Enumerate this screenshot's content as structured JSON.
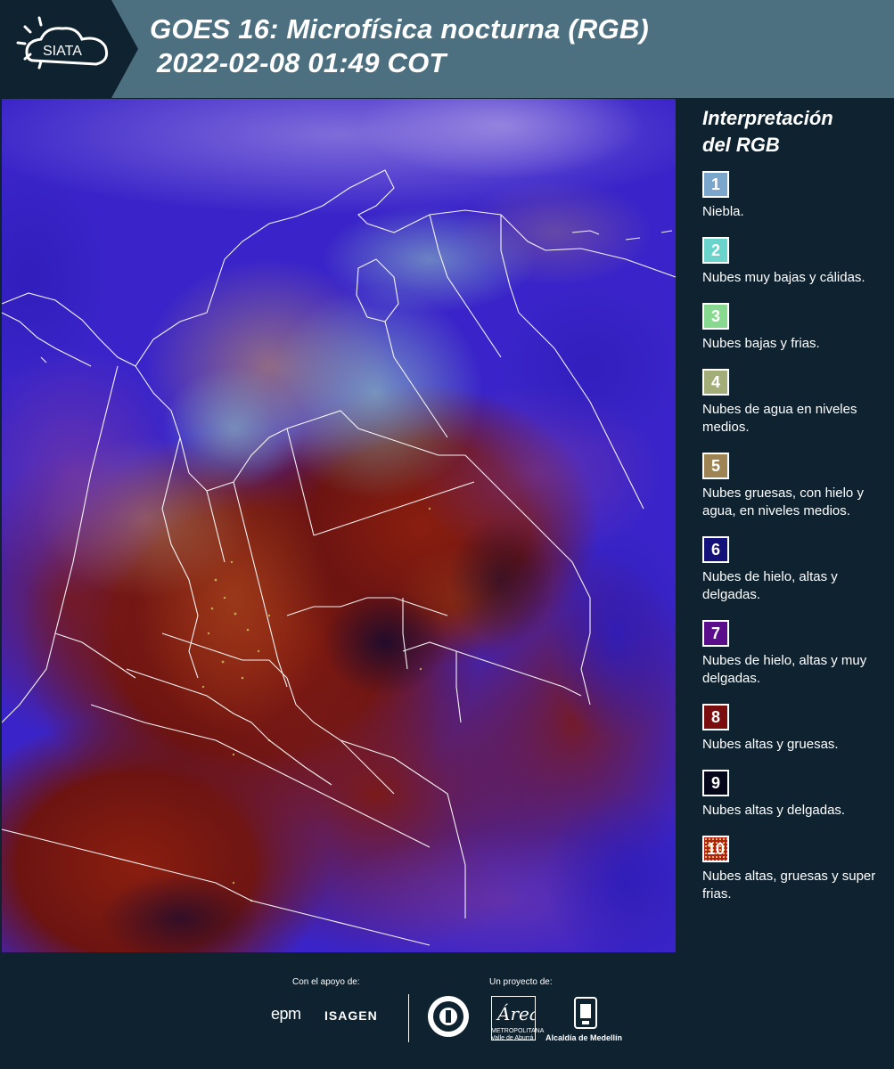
{
  "header": {
    "logo_text": "SIATA",
    "title_line1": "GOES 16: Microfísica nocturna (RGB)",
    "title_line2": "2022-02-08 01:49 COT"
  },
  "legend": {
    "title_line1": "Interpretación",
    "title_line2": "del RGB",
    "items": [
      {
        "number": "1",
        "label": "Niebla.",
        "color": "#7aa6cc"
      },
      {
        "number": "2",
        "label": "Nubes muy bajas y cálidas.",
        "color": "#6ad3cc"
      },
      {
        "number": "3",
        "label": "Nubes bajas y frias.",
        "color": "#86d98f"
      },
      {
        "number": "4",
        "label": "Nubes de agua en niveles medios.",
        "color": "#a3ad78"
      },
      {
        "number": "5",
        "label": "Nubes gruesas, con hielo y agua, en niveles medios.",
        "color": "#9e8452"
      },
      {
        "number": "6",
        "label": "Nubes de hielo, altas y delgadas.",
        "color": "#15117b"
      },
      {
        "number": "7",
        "label": "Nubes de hielo, altas y muy delgadas.",
        "color": "#5b0e8b"
      },
      {
        "number": "8",
        "label": "Nubes altas y gruesas.",
        "color": "#7a0d0d"
      },
      {
        "number": "9",
        "label": "Nubes altas y delgadas.",
        "color": "#06061a"
      },
      {
        "number": "10",
        "label": "Nubes altas, gruesas y super frias.",
        "color": "#b51e12"
      }
    ]
  },
  "footer": {
    "support_label": "Con el apoyo de:",
    "project_label": "Un proyecto de:",
    "epm_logo": "epm",
    "isagen_logo": "ISAGEN",
    "amva_logo_text": "METROPOLITANA Valle de Aburrá",
    "alcaldia_logo_text": "Alcaldía de Medellín"
  },
  "colors": {
    "header_bg": "#4d7080",
    "page_bg": "#0e2230",
    "map_blue": "#3a24c9",
    "map_red": "#6e1410"
  }
}
